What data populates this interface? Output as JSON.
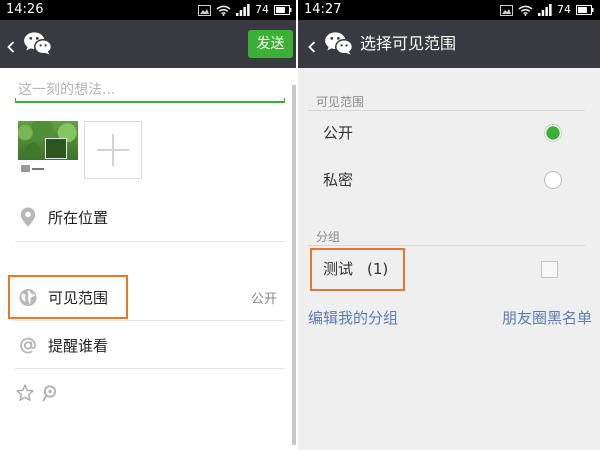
{
  "colors": {
    "status_bar_bg": "#000000",
    "header_bg": "#393a3f",
    "accent_green": "#3cb034",
    "highlight_orange": "#e8762b",
    "link_blue": "#5b7db5"
  },
  "left_screen": {
    "status_bar": {
      "time": "14:26",
      "battery": "74",
      "icons": [
        "image-icon",
        "wifi-icon",
        "signal-icon",
        "battery-icon"
      ]
    },
    "header": {
      "back_icon": "chevron-left-icon",
      "logo_icon": "wechat-logo-icon",
      "send_label": "发送"
    },
    "composer": {
      "placeholder": "这一刻的想法..."
    },
    "media": {
      "add_icon": "plus-icon"
    },
    "options": [
      {
        "icon": "location-pin-icon",
        "label": "所在位置"
      },
      {
        "icon": "globe-icon",
        "label": "可见范围",
        "value": "公开"
      },
      {
        "icon": "at-icon",
        "label": "提醒谁看"
      }
    ],
    "share_icons": [
      "star-icon",
      "tencent-weibo-icon"
    ]
  },
  "right_screen": {
    "status_bar": {
      "time": "14:27",
      "battery": "74",
      "icons": [
        "image-icon",
        "wifi-icon",
        "signal-icon",
        "battery-icon"
      ]
    },
    "header": {
      "back_icon": "chevron-left-icon",
      "logo_icon": "wechat-logo-icon",
      "title": "选择可见范围"
    },
    "visibility": {
      "section_title": "可见范围",
      "options": [
        {
          "label": "公开",
          "selected": true
        },
        {
          "label": "私密",
          "selected": false
        }
      ]
    },
    "groups": {
      "section_title": "分组",
      "items": [
        {
          "label": "测试",
          "count": "(1)",
          "checked": false
        }
      ]
    },
    "links": {
      "edit_groups": "编辑我的分组",
      "blacklist": "朋友圈黑名单"
    }
  }
}
